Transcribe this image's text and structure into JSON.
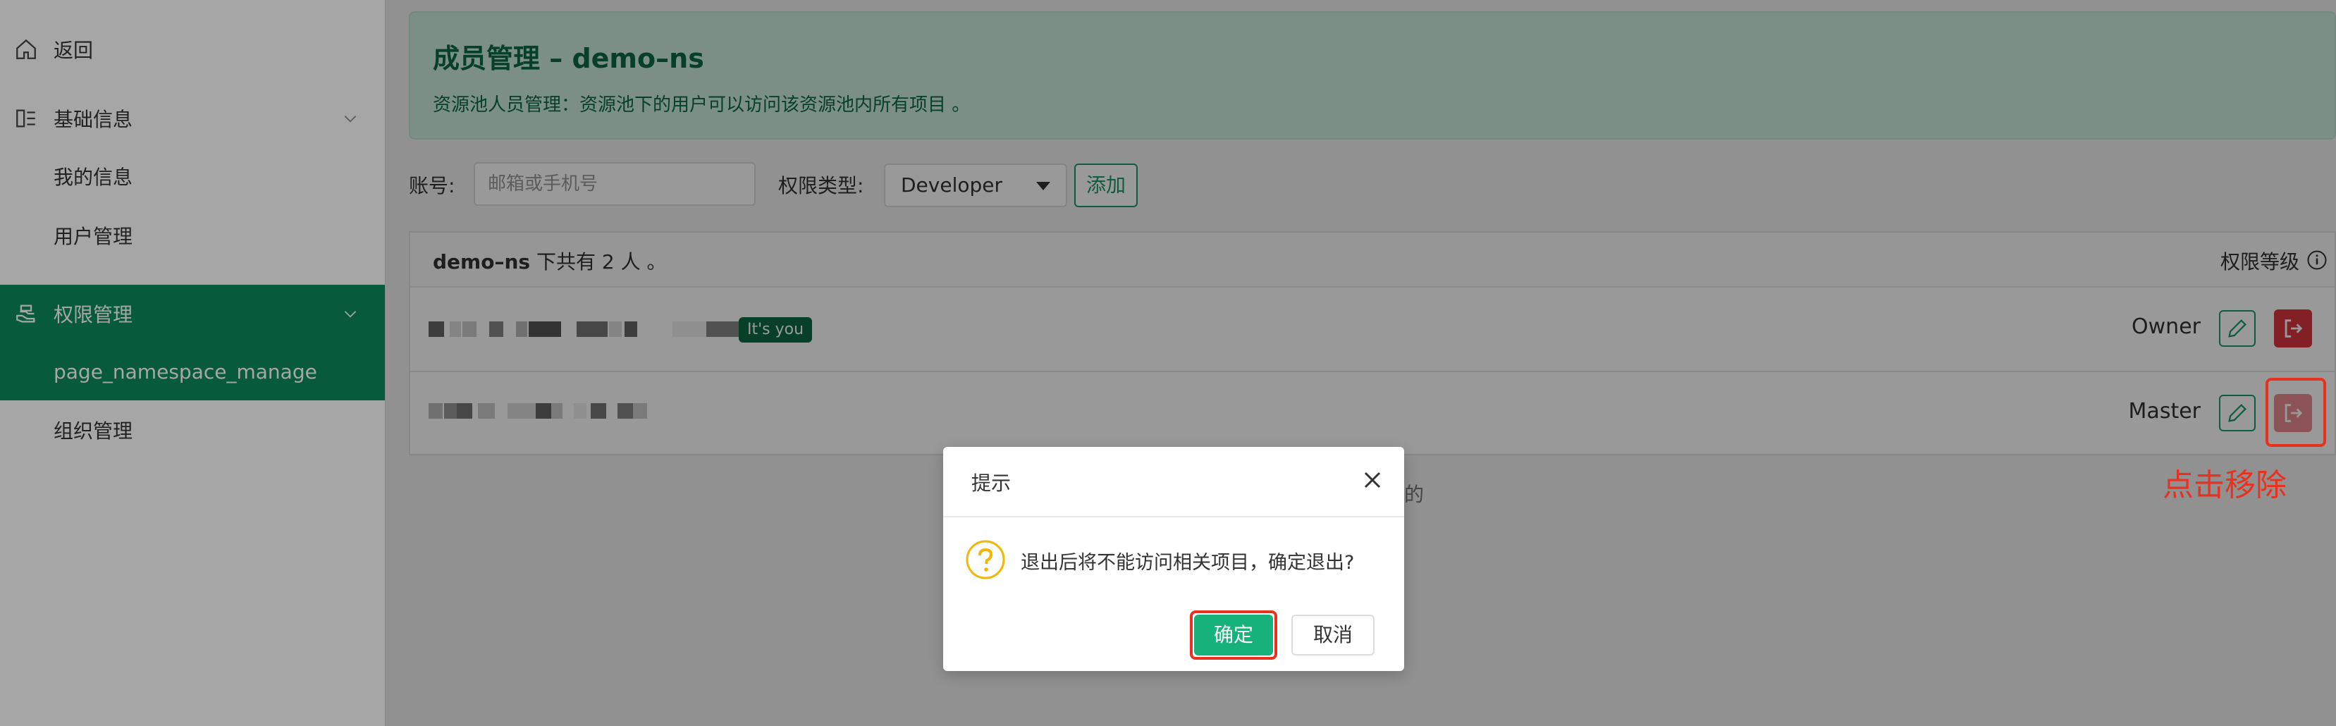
{
  "sidebar": {
    "items": [
      {
        "label": "返回",
        "icon": "home-icon"
      },
      {
        "label": "基础信息",
        "icon": "dashboard-icon"
      },
      {
        "label": "我的信息"
      },
      {
        "label": "用户管理"
      },
      {
        "label": "权限管理",
        "icon": "hand-icon"
      },
      {
        "label": "page_namespace_manage"
      },
      {
        "label": "组织管理"
      }
    ]
  },
  "banner": {
    "title": "成员管理 – demo–ns",
    "description": "资源池人员管理：资源池下的用户可以访问该资源池内所有项目 。"
  },
  "form": {
    "account_label": "账号:",
    "account_placeholder": "邮箱或手机号",
    "role_label": "权限类型:",
    "role_value": "Developer",
    "add_button": "添加"
  },
  "table": {
    "namespace": "demo–ns",
    "summary": "下共有 2 人 。",
    "role_header": "权限等级",
    "rows": [
      {
        "tag": "It's you",
        "role": "Owner"
      },
      {
        "role": "Master"
      }
    ]
  },
  "annotations": {
    "remove_hint": "点击移除",
    "confirm_hint": "确定"
  },
  "dialog": {
    "title": "提示",
    "message": "退出后将不能访问相关项目，确定退出?",
    "ok": "确定",
    "cancel": "取消",
    "behind_text": "的"
  },
  "colors": {
    "brand": "#0c8c5a",
    "danger": "#d9363e",
    "annotation": "#e8321f"
  }
}
